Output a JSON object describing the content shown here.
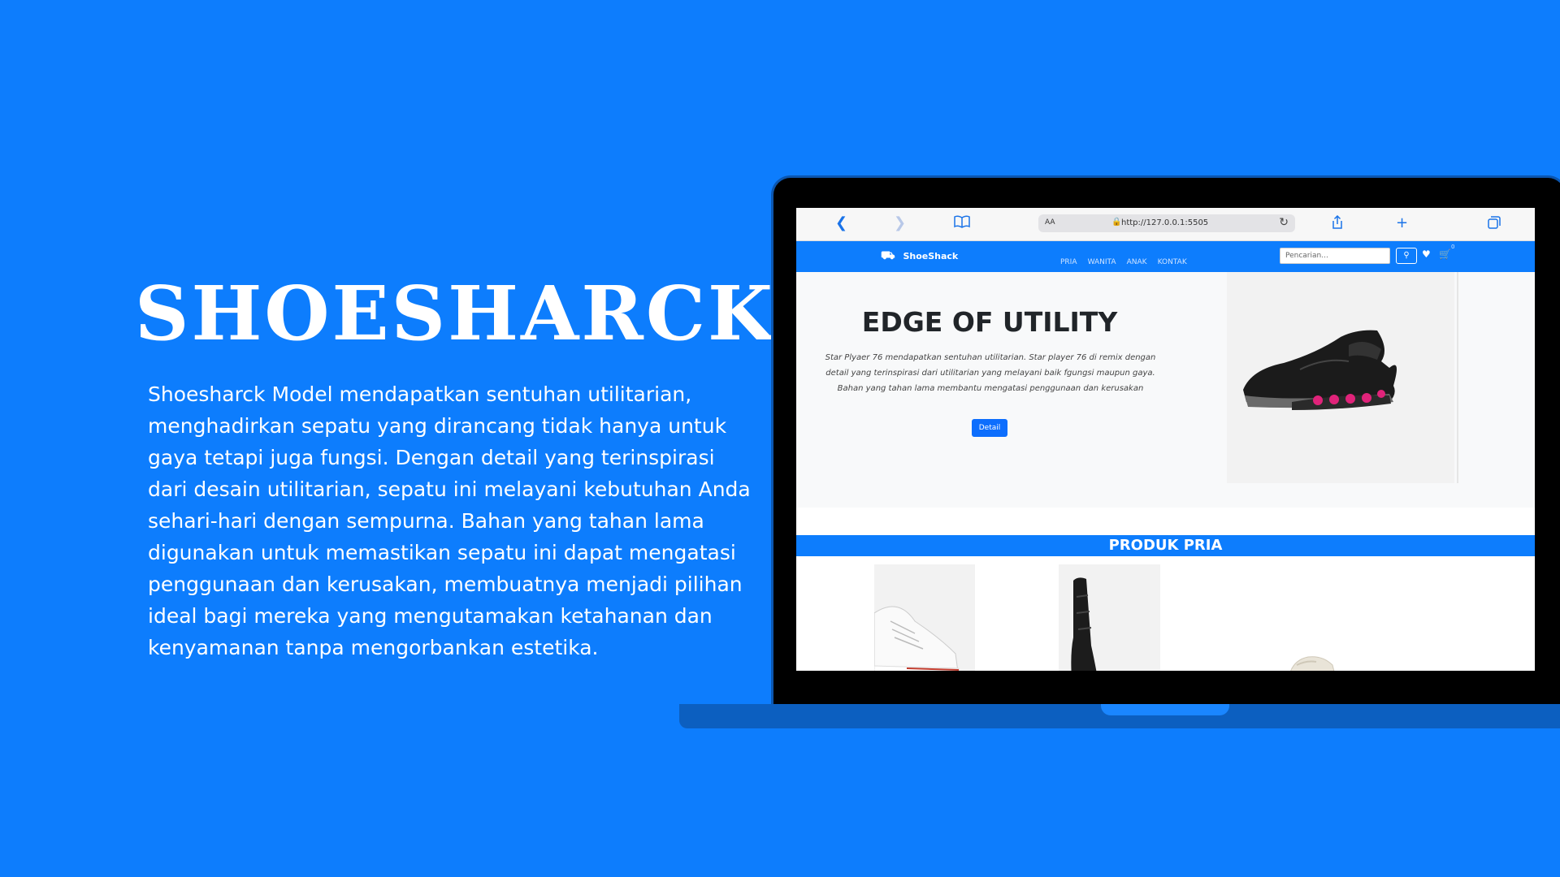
{
  "hero": {
    "title": "SHOESHARCK",
    "description": "Shoesharck Model mendapatkan sentuhan utilitarian, menghadirkan sepatu yang dirancang tidak hanya untuk gaya tetapi juga fungsi. Dengan detail yang terinspirasi dari desain utilitarian, sepatu ini melayani kebutuhan Anda sehari-hari dengan sempurna. Bahan yang tahan lama digunakan untuk memastikan sepatu ini dapat mengatasi penggunaan dan kerusakan, membuatnya menjadi pilihan ideal bagi mereka yang mengutamakan ketahanan dan kenyamanan tanpa mengorbankan estetika."
  },
  "browser": {
    "aa_label": "AA",
    "url": "http://127.0.0.1:5505",
    "icons": [
      "back-icon",
      "forward-icon",
      "bookmarks-icon",
      "lock-icon",
      "reload-icon",
      "share-icon",
      "new-tab-icon",
      "tabs-icon"
    ]
  },
  "site": {
    "brand": "ShoeShack",
    "nav": [
      "PRIA",
      "WANITA",
      "ANAK",
      "KONTAK"
    ],
    "search_placeholder": "Pencarian...",
    "cart_count": "0"
  },
  "banner": {
    "title": "EDGE OF UTILITY",
    "description": "Star Plyaer 76 mendapatkan sentuhan utilitarian. Star player 76 di remix dengan detail yang terinspirasi dari utilitarian yang melayani baik fgungsi maupun gaya. Bahan yang tahan lama membantu mengatasi penggunaan dan kerusakan",
    "button": "Detail"
  },
  "products_section": {
    "title": "PRODUK PRIA"
  },
  "colors": {
    "brand_blue": "#0d7dfd",
    "button_blue": "#0d6efd",
    "shoe_accent": "#e0237a"
  }
}
